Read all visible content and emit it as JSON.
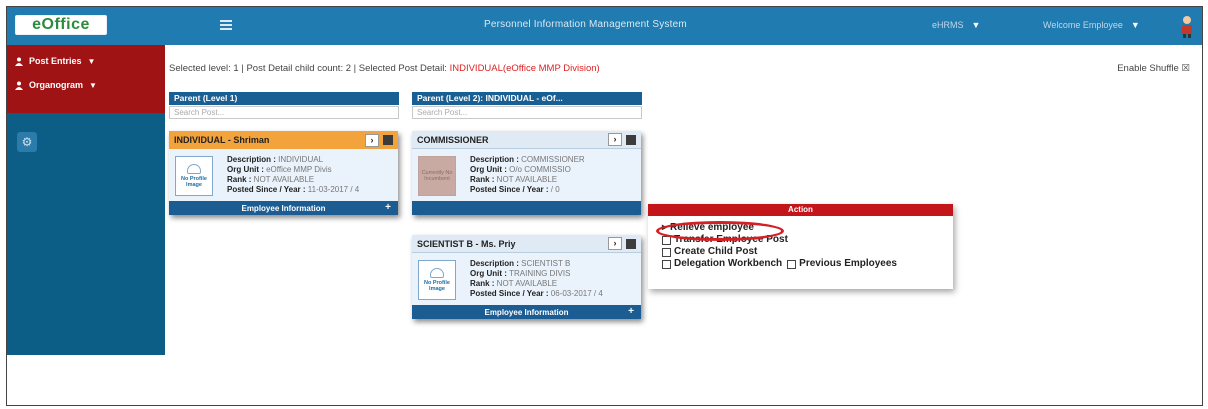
{
  "app": {
    "logo": "eOffice",
    "title": "Personnel Information Management System",
    "top_dropdown_1": "eHRMS",
    "user_dropdown": "Welcome Employee"
  },
  "sidebar": {
    "items": [
      {
        "label": "Post Entries",
        "icon": "user-icon"
      },
      {
        "label": "Organogram",
        "icon": "user-icon"
      }
    ],
    "gear_icon": "gear-icon"
  },
  "info": {
    "prefix": "Selected level: 1 | Post Detail child count: 2 | Selected Post Detail: ",
    "selected_post": "INDIVIDUAL(eOffice MMP Division)",
    "enable_shuffle": "Enable Shuffle"
  },
  "columns": [
    {
      "header": "Parent (Level 1)",
      "search_placeholder": "Search Post..."
    },
    {
      "header": "Parent (Level 2): INDIVIDUAL - eOf...",
      "search_placeholder": "Search Post..."
    }
  ],
  "cards": [
    {
      "name": "INDIVIDUAL - Shriman",
      "photo_text": "No Profile Image",
      "description_label": "Description : ",
      "description": "INDIVIDUAL",
      "org_unit_label": "Org Unit : ",
      "org_unit": "eOffice MMP Divis",
      "rank_label": "Rank : ",
      "rank": "NOT AVAILABLE",
      "posted_label": "Posted Since / Year : ",
      "posted": "11-03-2017 / 4",
      "footer": "Employee Information"
    },
    {
      "name": "COMMISSIONER",
      "photo_text": "Currently No Incumbent",
      "description_label": "Description : ",
      "description": "COMMISSIONER",
      "org_unit_label": "Org Unit : ",
      "org_unit": "O/o COMMISSIO",
      "rank_label": "Rank : ",
      "rank": "NOT AVAILABLE",
      "posted_label": "Posted Since / Year : ",
      "posted": "/ 0",
      "footer": ""
    },
    {
      "name": "SCIENTIST B - Ms. Priy",
      "photo_text": "No Profile Image",
      "description_label": "Description : ",
      "description": "SCIENTIST B",
      "org_unit_label": "Org Unit : ",
      "org_unit": "TRAINING DIVIS",
      "rank_label": "Rank : ",
      "rank": "NOT AVAILABLE",
      "posted_label": "Posted Since / Year : ",
      "posted": "06-03-2017 / 4",
      "footer": "Employee Information"
    }
  ],
  "action_menu": {
    "title": "Action",
    "items": [
      "Relieve employee",
      "Transfer Employee Post",
      "Create Child Post",
      "Delegation Workbench",
      "Previous Employees"
    ]
  }
}
